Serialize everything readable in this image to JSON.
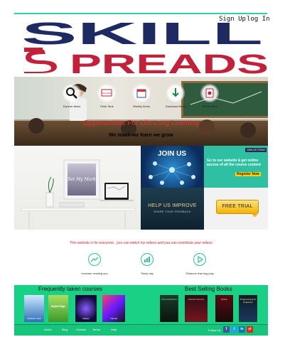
{
  "header": {
    "signup_label": "Sign Up",
    "login_label": "log In",
    "logo_line1": "SKILL",
    "logo_line2": "PREADS"
  },
  "hero": {
    "icons": [
      {
        "label": "Explore Items",
        "icon": "magnifier-icon"
      },
      {
        "label": "Think Tank",
        "icon": "teaching-icon"
      },
      {
        "label": "Weekly Items",
        "icon": "calendar-icon"
      },
      {
        "label": "Download items",
        "icon": "download-icon"
      },
      {
        "label": "What's New",
        "icon": "new-icon"
      }
    ],
    "board_text": "TEACHING",
    "tagline_red": "Opportunities For Life Long Learning",
    "tagline_black": "We teach we learn we grow"
  },
  "promo": {
    "poster_text": "Set My Mark",
    "join_label": "JOIN US",
    "teal_heading": "JOIN US TODAY",
    "teal_text": "Go to our website & get online access of all the course content",
    "teal_highlight": "Register Now",
    "help_title": "HELP US IMPROVE",
    "help_sub": "SHARE YOUR FEEDBACK",
    "trial_label": "FREE TRIAL"
  },
  "info": {
    "statement": "This website is for everyone , you can watch my videos and you can contribute your videos",
    "features": [
      {
        "label": "Increase reading you",
        "icon": "trend-icon"
      },
      {
        "label": "Study day",
        "icon": "bar-chart-icon"
      },
      {
        "label": "Distance learning play",
        "icon": "play-icon"
      }
    ]
  },
  "courses": {
    "title": "Frequently taken courses",
    "items": [
      "Software Tools",
      "Digital Edge",
      "Galaxy",
      "Tutorial"
    ]
  },
  "books": {
    "title": "Best Selling Books",
    "items": [
      "Virtual Machines",
      "Network Security",
      "Python",
      "Programming for Engineers"
    ]
  },
  "footer": {
    "links": [
      "About",
      "Blog",
      "Contact",
      "Terms",
      "Help"
    ],
    "follow_label": "Follow Us",
    "social": [
      "f",
      "t",
      "in",
      "yt"
    ]
  },
  "colors": {
    "navy": "#1e2a62",
    "crimson": "#c3203a",
    "teal": "#2fd3a2",
    "green": "#18d185"
  }
}
